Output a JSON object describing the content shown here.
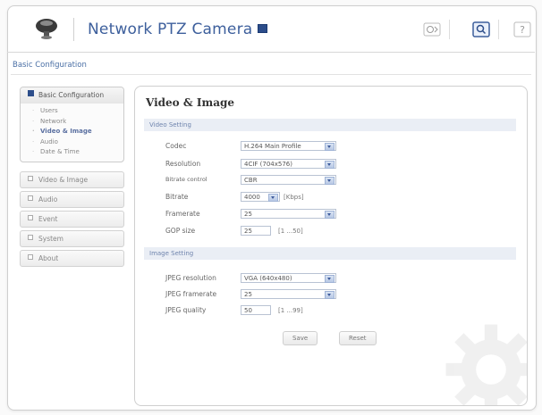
{
  "header": {
    "product_title": "Network PTZ Camera",
    "icons": [
      "ptz-control-icon",
      "live-view-icon",
      "help-icon"
    ]
  },
  "breadcrumb": "Basic Configuration",
  "sidebar": {
    "active_group": "Basic Configuration",
    "sub_items": [
      "Users",
      "Network",
      "Video & Image",
      "Audio",
      "Date & Time"
    ],
    "active_sub_item": "Video & Image",
    "groups": [
      "Video & Image",
      "Audio",
      "Event",
      "System",
      "About"
    ]
  },
  "panel": {
    "title": "Video & Image",
    "video_section": {
      "header": "Video Setting",
      "codec_label": "Codec",
      "codec_value": "H.264 Main Profile",
      "resolution_label": "Resolution",
      "resolution_value": "4CIF (704x576)",
      "bitrate_control_label": "Bitrate control",
      "bitrate_control_value": "CBR",
      "bitrate_label": "Bitrate",
      "bitrate_value": "4000",
      "bitrate_unit": "[Kbps]",
      "framerate_label": "Framerate",
      "framerate_value": "25",
      "gop_label": "GOP size",
      "gop_value": "25",
      "gop_range": "[1 ...50]"
    },
    "image_section": {
      "header": "Image Setting",
      "jpeg_resolution_label": "JPEG resolution",
      "jpeg_resolution_value": "VGA (640x480)",
      "jpeg_framerate_label": "JPEG framerate",
      "jpeg_framerate_value": "25",
      "jpeg_quality_label": "JPEG quality",
      "jpeg_quality_value": "50",
      "jpeg_quality_range": "[1 ...99]"
    },
    "save_label": "Save",
    "reset_label": "Reset"
  },
  "colors": {
    "accent": "#3d5f9c",
    "section_bar": "#eaeef5"
  }
}
